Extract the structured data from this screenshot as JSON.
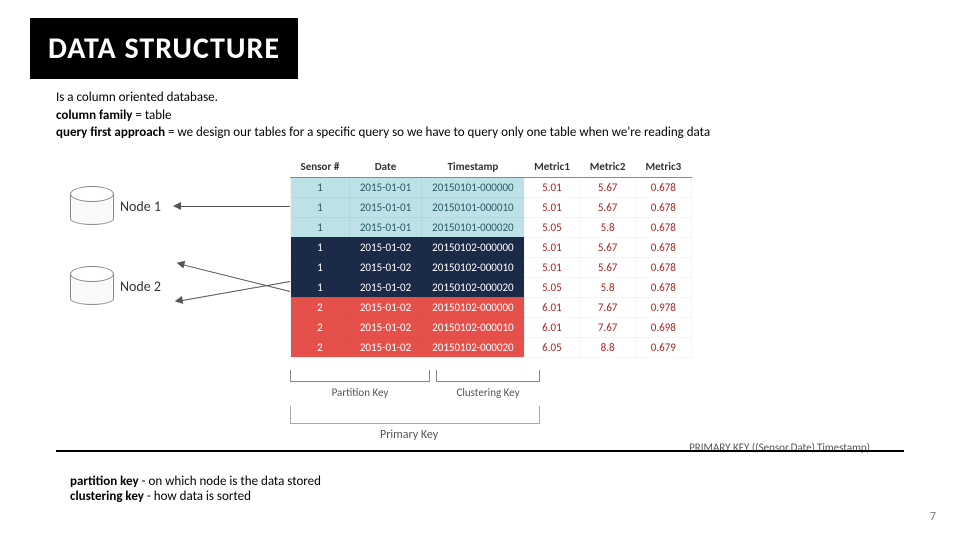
{
  "title": "DATA STRUCTURE",
  "desc_line1": "Is a column oriented database.",
  "desc_cf_bold": "column family",
  "desc_cf_rest": " = table",
  "desc_qf_bold": "query first approach",
  "desc_qf_rest": " = we design our tables for a specific query so we have to query only one table when we're reading data",
  "node1": "Node 1",
  "node2": "Node 2",
  "headers": {
    "sensor": "Sensor #",
    "date": "Date",
    "ts": "Timestamp",
    "m1": "Metric1",
    "m2": "Metric2",
    "m3": "Metric3"
  },
  "rows": [
    {
      "part": "p1",
      "s": "1",
      "d": "2015-01-01",
      "t": "20150101-000000",
      "m1": "5.01",
      "m2": "5.67",
      "m3": "0.678"
    },
    {
      "part": "p1",
      "s": "1",
      "d": "2015-01-01",
      "t": "20150101-000010",
      "m1": "5.01",
      "m2": "5.67",
      "m3": "0.678"
    },
    {
      "part": "p1",
      "s": "1",
      "d": "2015-01-01",
      "t": "20150101-000020",
      "m1": "5.05",
      "m2": "5.8",
      "m3": "0.678"
    },
    {
      "part": "p2",
      "s": "1",
      "d": "2015-01-02",
      "t": "20150102-000000",
      "m1": "5.01",
      "m2": "5.67",
      "m3": "0.678"
    },
    {
      "part": "p2",
      "s": "1",
      "d": "2015-01-02",
      "t": "20150102-000010",
      "m1": "5.01",
      "m2": "5.67",
      "m3": "0.678"
    },
    {
      "part": "p2",
      "s": "1",
      "d": "2015-01-02",
      "t": "20150102-000020",
      "m1": "5.05",
      "m2": "5.8",
      "m3": "0.678"
    },
    {
      "part": "p3",
      "s": "2",
      "d": "2015-01-02",
      "t": "20150102-000000",
      "m1": "6.01",
      "m2": "7.67",
      "m3": "0.978"
    },
    {
      "part": "p3",
      "s": "2",
      "d": "2015-01-02",
      "t": "20150102-000010",
      "m1": "6.01",
      "m2": "7.67",
      "m3": "0.698"
    },
    {
      "part": "p3",
      "s": "2",
      "d": "2015-01-02",
      "t": "20150102-000020",
      "m1": "6.05",
      "m2": "8.8",
      "m3": "0.679"
    }
  ],
  "labels": {
    "partition": "Partition Key",
    "clustering": "Clustering Key",
    "primary": "Primary Key",
    "pk_def": "PRIMARY KEY ((Sensor,Date),Timestamp)"
  },
  "key_pk_bold": "partition key",
  "key_pk_rest": " - on which node is the data stored",
  "key_ck_bold": "clustering key",
  "key_ck_rest": " - how data is sorted",
  "page": "7"
}
